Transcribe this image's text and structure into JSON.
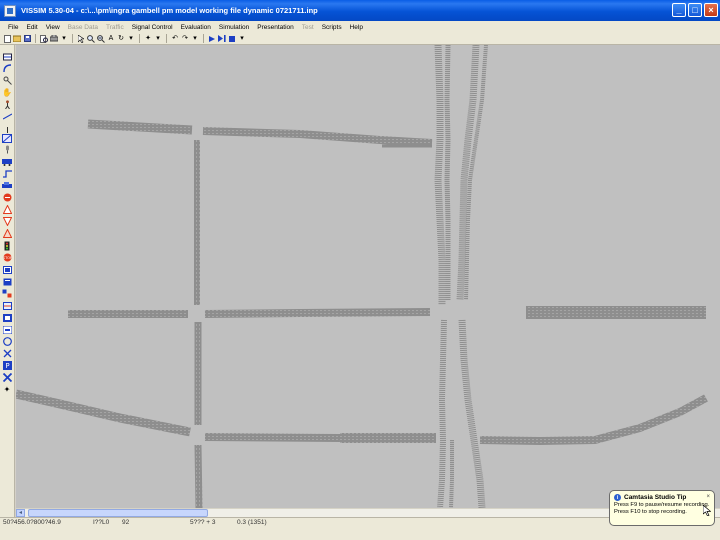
{
  "window": {
    "title": "VISSIM 5.30-04 - c:\\...\\pm\\ingra gambell pm model working file dynamic 0721711.inp",
    "minimize": "_",
    "maximize": "□",
    "close": "×"
  },
  "menu": {
    "items": [
      {
        "label": "File",
        "enabled": true
      },
      {
        "label": "Edit",
        "enabled": true
      },
      {
        "label": "View",
        "enabled": true
      },
      {
        "label": "Base Data",
        "enabled": false
      },
      {
        "label": "Traffic",
        "enabled": false
      },
      {
        "label": "Signal Control",
        "enabled": true
      },
      {
        "label": "Evaluation",
        "enabled": true
      },
      {
        "label": "Simulation",
        "enabled": true
      },
      {
        "label": "Presentation",
        "enabled": true
      },
      {
        "label": "Test",
        "enabled": false
      },
      {
        "label": "Scripts",
        "enabled": true
      },
      {
        "label": "Help",
        "enabled": true
      }
    ]
  },
  "toolbar": {
    "zoom_char": "A",
    "rotate_char": "↻",
    "undo_char": "↶",
    "redo_char": "↷"
  },
  "status": {
    "coords": "50?456.0?800?46.9",
    "field2": "I??L0",
    "field3": "92",
    "field4": "5??? + 3",
    "field5": "0.3 (1351)"
  },
  "tooltip": {
    "title": "Camtasia Studio Tip",
    "icon_char": "i",
    "close_char": "×",
    "line1": "Press F9 to pause/resume recording.",
    "line2": "Press F10 to stop recording."
  },
  "colors": {
    "canvas": "#c0c0c0",
    "link": "#8e8e8e",
    "title_bar": "#0553d6"
  }
}
